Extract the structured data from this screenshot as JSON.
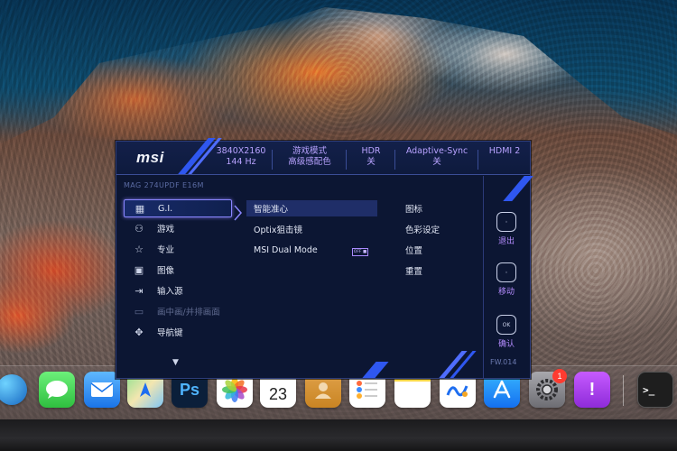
{
  "osd": {
    "brand": "msi",
    "model": "MAG 274UPDF E16M",
    "header": [
      {
        "line1": "3840X2160",
        "line2": "144 Hz"
      },
      {
        "line1": "游戏模式",
        "line2": "高级感配色"
      },
      {
        "line1": "HDR",
        "line2": "关"
      },
      {
        "line1": "Adaptive-Sync",
        "line2": "关"
      },
      {
        "line1": "HDMI 2",
        "line2": ""
      }
    ],
    "menu": [
      {
        "label": "G.I.",
        "icon": "gi-icon",
        "glyph": "▦"
      },
      {
        "label": "游戏",
        "icon": "gamepad-icon",
        "glyph": "⚇"
      },
      {
        "label": "专业",
        "icon": "star-icon",
        "glyph": "☆"
      },
      {
        "label": "图像",
        "icon": "image-icon",
        "glyph": "▣"
      },
      {
        "label": "输入源",
        "icon": "input-source-icon",
        "glyph": "⇥"
      },
      {
        "label": "画中画/并排画面",
        "icon": "pip-icon",
        "glyph": "▭"
      },
      {
        "label": "导航键",
        "icon": "navigation-key-icon",
        "glyph": "✥"
      }
    ],
    "submenu": [
      {
        "label": "智能准心"
      },
      {
        "label": "Optix狙击镜"
      },
      {
        "label": "MSI Dual Mode"
      }
    ],
    "dual_mode_badge": "OFF ■",
    "third_col": [
      "图标",
      "色彩设定",
      "位置",
      "重置"
    ],
    "nav": [
      {
        "label": "退出",
        "icon": "exit-button-icon"
      },
      {
        "label": "移动",
        "icon": "move-button-icon"
      },
      {
        "label": "确认",
        "icon": "ok-button-icon",
        "glyph": "OK"
      }
    ],
    "fw": "FW.014"
  },
  "dock": {
    "calendar_day": "23",
    "settings_badge": "1",
    "photoshop_label": "Ps",
    "terminal_label": ">_"
  },
  "colors": {
    "osd_bg": "#0c1633",
    "accent_purple": "#b9a3ff",
    "accent_blue": "#2f57f0"
  }
}
